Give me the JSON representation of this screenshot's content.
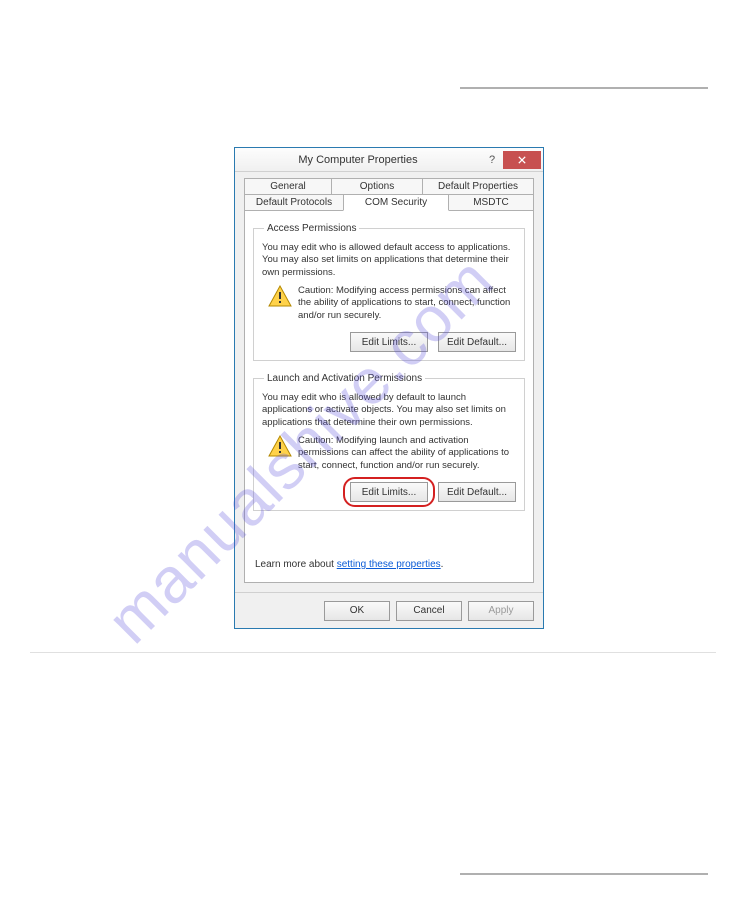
{
  "watermark": "manualshive.com",
  "dialog": {
    "title": "My Computer Properties",
    "help_glyph": "?",
    "tabs_row1": [
      "General",
      "Options",
      "Default Properties"
    ],
    "tabs_row2": [
      "Default Protocols",
      "COM Security",
      "MSDTC"
    ],
    "active_tab": "COM Security",
    "access": {
      "legend": "Access Permissions",
      "desc": "You may edit who is allowed default access to applications. You may also set limits on applications that determine their own permissions.",
      "caution": "Caution: Modifying access permissions can affect the ability of applications to start, connect, function and/or run securely.",
      "edit_limits": "Edit Limits...",
      "edit_default": "Edit Default..."
    },
    "launch": {
      "legend": "Launch and Activation Permissions",
      "desc": "You may edit who is allowed by default to launch applications or activate objects. You may also set limits on applications that determine their own permissions.",
      "caution": "Caution: Modifying launch and activation permissions can affect the ability of applications to start, connect, function and/or run securely.",
      "edit_limits": "Edit Limits...",
      "edit_default": "Edit Default..."
    },
    "learn_prefix": "Learn more about ",
    "learn_link": "setting these properties",
    "learn_suffix": ".",
    "footer": {
      "ok": "OK",
      "cancel": "Cancel",
      "apply": "Apply"
    }
  }
}
